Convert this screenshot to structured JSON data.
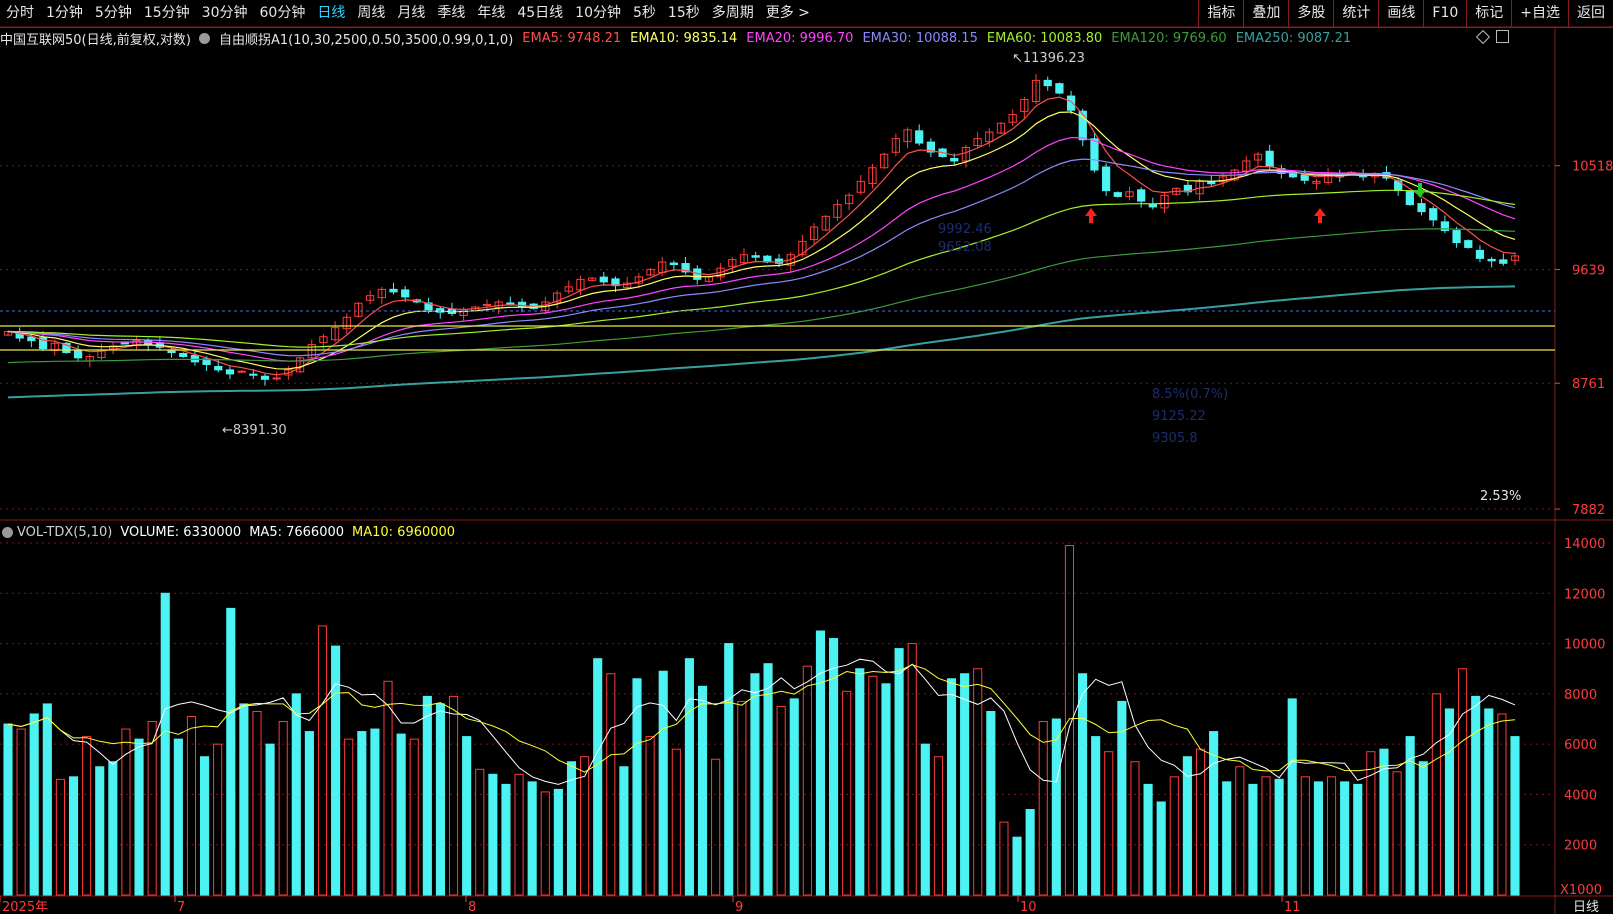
{
  "toolbar": {
    "left": [
      "分时",
      "1分钟",
      "5分钟",
      "15分钟",
      "30分钟",
      "60分钟",
      "日线",
      "周线",
      "月线",
      "季线",
      "年线",
      "45日线",
      "10分钟",
      "5秒",
      "15秒",
      "多周期",
      "更多 >"
    ],
    "active": "日线",
    "right": [
      "指标",
      "叠加",
      "多股",
      "统计",
      "画线",
      "F10",
      "标记",
      "+自选",
      "返回"
    ]
  },
  "legend": {
    "title": "中国互联网50(日线,前复权,对数)",
    "indicator": "自由顺拐A1(10,30,2500,0.50,3500,0.99,0,1,0)",
    "ema": [
      {
        "label": "EMA5: 9748.21",
        "color": "#ff4d4d"
      },
      {
        "label": "EMA10: 9835.14",
        "color": "#ffff66"
      },
      {
        "label": "EMA20: 9996.70",
        "color": "#ff44ff"
      },
      {
        "label": "EMA30: 10088.15",
        "color": "#8a8aff"
      },
      {
        "label": "EMA60: 10083.80",
        "color": "#a4f02a"
      },
      {
        "label": "EMA120: 9769.60",
        "color": "#3d9c3d"
      },
      {
        "label": "EMA250: 9087.21",
        "color": "#39a0a0"
      }
    ]
  },
  "price_axis": [
    "10518",
    "9639",
    "8761",
    "7882"
  ],
  "vol_axis": [
    "14000",
    "12000",
    "10000",
    "8000",
    "6000",
    "4000",
    "2000"
  ],
  "vol_unit": "X1000",
  "annotations": {
    "high": "11396.23",
    "low": "8391.30",
    "pct": "2.53%"
  },
  "faint_text": [
    "9992.46",
    "9652.08",
    "8.5%(0.7%)",
    "9125.22",
    "9305.8"
  ],
  "volume_legend": [
    {
      "label": "VOL-TDX(5,10)",
      "color": "#d0d0d0"
    },
    {
      "label": "VOLUME: 6330000",
      "color": "#ffffff"
    },
    {
      "label": "MA5: 7666000",
      "color": "#ffffff"
    },
    {
      "label": "MA10: 6960000",
      "color": "#ffff33"
    }
  ],
  "time_axis": [
    "2025年",
    "7",
    "8",
    "9",
    "10",
    "11"
  ],
  "period_label": "日线",
  "colors": {
    "up": "#ff3b3b",
    "down": "#4df2f2",
    "frame": "#8a1c1c",
    "ema5": "#ff4d4d",
    "ema10": "#ffff66",
    "ema20": "#ff44ff",
    "ema30": "#8a8aff",
    "ema60": "#a4f02a",
    "ema120": "#3d9c3d",
    "ema250": "#39a0a0",
    "vol_ma5": "#ffffff",
    "vol_ma10": "#ffff33"
  },
  "chart_data": {
    "type": "candlestick",
    "ylim_price": [
      7882,
      11396.23
    ],
    "ylim_volume": [
      0,
      14000
    ],
    "closes": [
      9150,
      9100,
      9080,
      9020,
      9060,
      8990,
      8950,
      8960,
      9010,
      9040,
      9060,
      9080,
      9050,
      9030,
      8990,
      8960,
      8920,
      8900,
      8860,
      8830,
      8850,
      8820,
      8790,
      8800,
      8860,
      8950,
      9050,
      9110,
      9180,
      9260,
      9370,
      9430,
      9480,
      9460,
      9420,
      9380,
      9320,
      9300,
      9290,
      9310,
      9340,
      9360,
      9380,
      9370,
      9340,
      9330,
      9380,
      9450,
      9500,
      9560,
      9570,
      9540,
      9510,
      9530,
      9580,
      9640,
      9700,
      9680,
      9620,
      9560,
      9580,
      9650,
      9720,
      9760,
      9740,
      9700,
      9690,
      9760,
      9870,
      9990,
      10080,
      10180,
      10260,
      10380,
      10500,
      10620,
      10760,
      10840,
      10720,
      10640,
      10600,
      10560,
      10680,
      10760,
      10820,
      10900,
      10980,
      11120,
      11300,
      11250,
      11180,
      11020,
      10750,
      10480,
      10300,
      10250,
      10290,
      10210,
      10160,
      10260,
      10320,
      10290,
      10380,
      10360,
      10420,
      10480,
      10560,
      10620,
      10510,
      10450,
      10420,
      10390,
      10380,
      10440,
      10420,
      10460,
      10420,
      10440,
      10410,
      10300,
      10180,
      10120,
      10050,
      9960,
      9860,
      9820,
      9730,
      9710,
      9690,
      9750
    ],
    "volumes": [
      6800,
      6600,
      7200,
      7600,
      4600,
      4700,
      6300,
      5100,
      5300,
      6600,
      6200,
      6900,
      12000,
      6200,
      7100,
      5500,
      6000,
      11400,
      7600,
      7300,
      6000,
      6900,
      8000,
      6500,
      10700,
      9900,
      6200,
      6500,
      6600,
      8500,
      6400,
      6200,
      7900,
      7600,
      7900,
      6300,
      5000,
      4800,
      4400,
      4800,
      4500,
      4100,
      4200,
      5300,
      5500,
      9400,
      8800,
      5100,
      8600,
      6300,
      8900,
      5800,
      9400,
      8300,
      5400,
      10000,
      7700,
      8800,
      9200,
      7500,
      7800,
      9100,
      10500,
      10200,
      8100,
      9000,
      8700,
      8400,
      9800,
      10000,
      6000,
      5500,
      8600,
      8800,
      9000,
      7300,
      2900,
      2300,
      3400,
      6900,
      7000,
      13900,
      8800,
      6300,
      5700,
      7700,
      5300,
      4400,
      3700,
      4700,
      5500,
      5800,
      6500,
      4500,
      5100,
      4400,
      4700,
      4600,
      7800,
      4700,
      4500,
      4700,
      4500,
      4400,
      5700,
      5800,
      4900,
      6300,
      5300,
      8000,
      7400,
      9000,
      7900,
      7400,
      7200,
      6300
    ],
    "time_ticks": [
      "2025年",
      "7",
      "8",
      "9",
      "10",
      "11"
    ]
  }
}
